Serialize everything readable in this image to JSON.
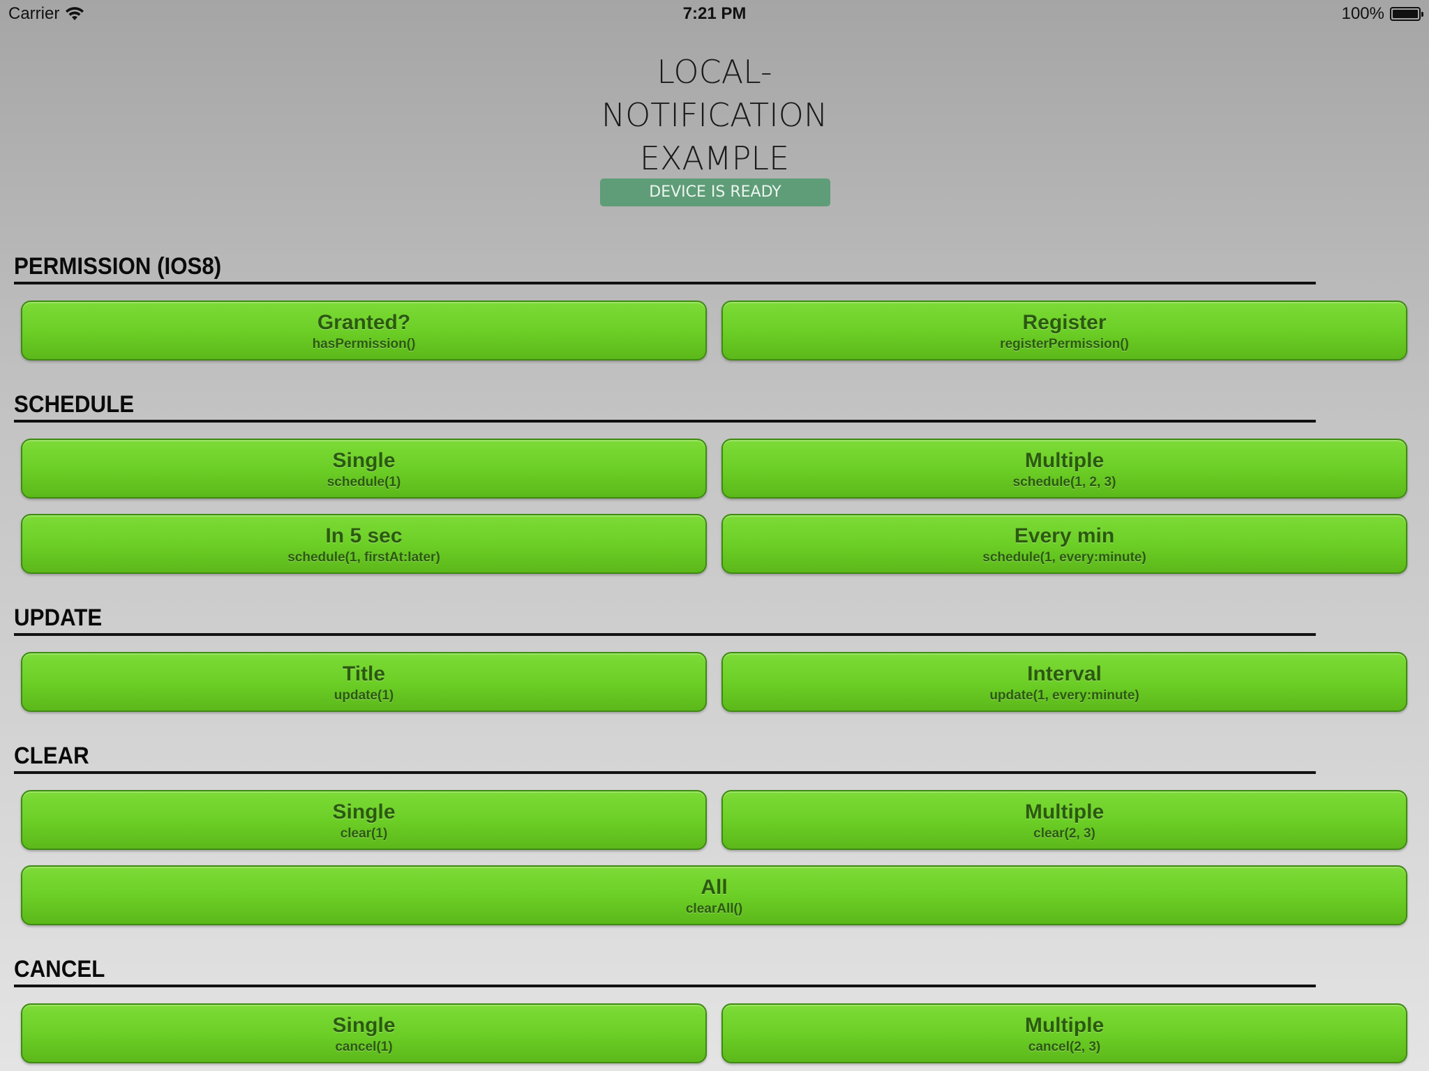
{
  "status_bar": {
    "carrier": "Carrier",
    "time": "7:21 PM",
    "battery": "100%"
  },
  "header": {
    "title_lines": [
      "LOCAL-",
      "NOTIFICATION",
      "EXAMPLE"
    ],
    "device_status": "DEVICE IS READY",
    "device_status_color": "#5f9c78"
  },
  "theme": {
    "button_green": "#6ccf26",
    "button_text": "#2b5a10"
  },
  "sections": {
    "permission": {
      "heading": "PERMISSION (IOS8)",
      "buttons": [
        {
          "title": "Granted?",
          "subtitle": "hasPermission()"
        },
        {
          "title": "Register",
          "subtitle": "registerPermission()"
        }
      ]
    },
    "schedule": {
      "heading": "SCHEDULE",
      "buttons": [
        {
          "title": "Single",
          "subtitle": "schedule(1)"
        },
        {
          "title": "Multiple",
          "subtitle": "schedule(1, 2, 3)"
        },
        {
          "title": "In 5 sec",
          "subtitle": "schedule(1, firstAt:later)"
        },
        {
          "title": "Every min",
          "subtitle": "schedule(1, every:minute)"
        }
      ]
    },
    "update": {
      "heading": "UPDATE",
      "buttons": [
        {
          "title": "Title",
          "subtitle": "update(1)"
        },
        {
          "title": "Interval",
          "subtitle": "update(1, every:minute)"
        }
      ]
    },
    "clear": {
      "heading": "CLEAR",
      "buttons": [
        {
          "title": "Single",
          "subtitle": "clear(1)"
        },
        {
          "title": "Multiple",
          "subtitle": "clear(2, 3)"
        },
        {
          "title": "All",
          "subtitle": "clearAll()"
        }
      ]
    },
    "cancel": {
      "heading": "CANCEL",
      "buttons": [
        {
          "title": "Single",
          "subtitle": "cancel(1)"
        },
        {
          "title": "Multiple",
          "subtitle": "cancel(2, 3)"
        }
      ]
    }
  }
}
